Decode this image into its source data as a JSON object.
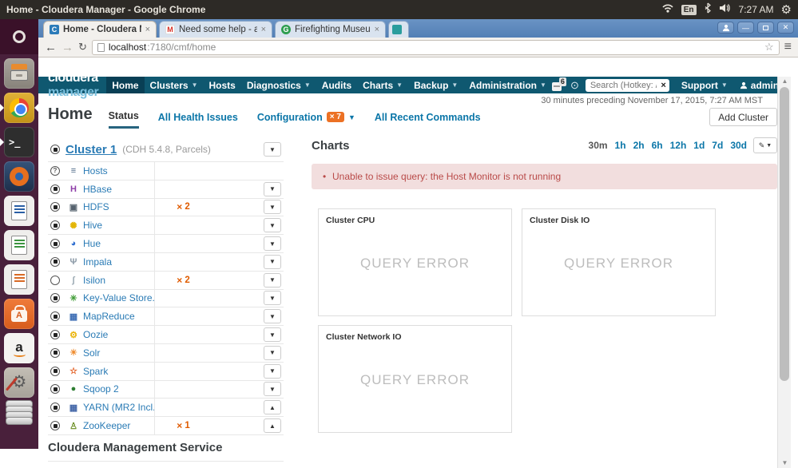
{
  "system_bar": {
    "title": "Home - Cloudera Manager - Google Chrome",
    "keyboard_indicator": "En",
    "time": "7:27 AM"
  },
  "launcher": {
    "items": [
      "ubuntu-dash",
      "files",
      "chrome",
      "terminal",
      "firefox",
      "libreoffice-writer",
      "libreoffice-calc",
      "libreoffice-impress",
      "software-center",
      "amazon",
      "system-settings",
      "disk-stack"
    ]
  },
  "browser": {
    "tabs": [
      {
        "label": "Home - Cloudera Ma",
        "favicon": "cloudera",
        "active": true,
        "partial": false
      },
      {
        "label": "Need some help - as",
        "favicon": "gmail",
        "active": false,
        "partial": false
      },
      {
        "label": "Firefighting Museu",
        "favicon": "g-green",
        "active": false,
        "partial": false
      },
      {
        "label": "",
        "favicon": "teal",
        "active": false,
        "partial": true
      }
    ],
    "url_host": "localhost",
    "url_path": ":7180/cmf/home"
  },
  "navbar": {
    "brand_primary": "cloudera",
    "brand_secondary": "manager",
    "items": [
      {
        "label": "Home",
        "active": true,
        "caret": false
      },
      {
        "label": "Clusters",
        "active": false,
        "caret": true
      },
      {
        "label": "Hosts",
        "active": false,
        "caret": false
      },
      {
        "label": "Diagnostics",
        "active": false,
        "caret": true
      },
      {
        "label": "Audits",
        "active": false,
        "caret": false
      },
      {
        "label": "Charts",
        "active": false,
        "caret": true
      },
      {
        "label": "Backup",
        "active": false,
        "caret": true
      },
      {
        "label": "Administration",
        "active": false,
        "caret": true
      }
    ],
    "parcel_badge": "6",
    "search_placeholder": "Search (Hotkey: /)",
    "support_label": "Support",
    "user_label": "admin"
  },
  "page": {
    "time_context": "30 minutes preceding November 17, 2015, 7:27 AM MST",
    "title": "Home",
    "tabs": [
      {
        "label": "Status",
        "active": true,
        "badge": "",
        "caret": false
      },
      {
        "label": "All Health Issues",
        "active": false,
        "badge": "",
        "caret": false
      },
      {
        "label": "Configuration",
        "active": false,
        "badge": "7",
        "caret": true
      },
      {
        "label": "All Recent Commands",
        "active": false,
        "badge": "",
        "caret": false
      }
    ],
    "add_cluster_label": "Add Cluster"
  },
  "cluster": {
    "name": "Cluster 1",
    "meta": "(CDH 5.4.8, Parcels)",
    "services": [
      {
        "name": "Hosts",
        "icon": "hosts",
        "glyph": "≡",
        "color": "#4a6785",
        "status": "unknown",
        "config_issues": "",
        "doc": false,
        "caret": ""
      },
      {
        "name": "HBase",
        "icon": "hbase",
        "glyph": "H",
        "color": "#8e3fa8",
        "status": "ok",
        "config_issues": "",
        "doc": true,
        "caret": "down"
      },
      {
        "name": "HDFS",
        "icon": "hdfs",
        "glyph": "▣",
        "color": "#55626e",
        "status": "ok",
        "config_issues": "2",
        "doc": true,
        "caret": "down"
      },
      {
        "name": "Hive",
        "icon": "hive",
        "glyph": "✺",
        "color": "#e3b505",
        "status": "ok",
        "config_issues": "",
        "doc": true,
        "caret": "down"
      },
      {
        "name": "Hue",
        "icon": "hue",
        "glyph": "◕",
        "color": "#2f6fd0",
        "status": "ok",
        "config_issues": "",
        "doc": false,
        "caret": "down"
      },
      {
        "name": "Impala",
        "icon": "impala",
        "glyph": "Ψ",
        "color": "#8a99a6",
        "status": "ok",
        "config_issues": "",
        "doc": false,
        "caret": "down"
      },
      {
        "name": "Isilon",
        "icon": "isilon",
        "glyph": "ʃ",
        "color": "#9aa9b2",
        "status": "none",
        "config_issues": "2",
        "doc": true,
        "caret": "down"
      },
      {
        "name": "Key-Value Store...",
        "icon": "kvstore",
        "glyph": "✳",
        "color": "#3f9c35",
        "status": "ok",
        "config_issues": "",
        "doc": false,
        "caret": "down"
      },
      {
        "name": "MapReduce",
        "icon": "mapreduce",
        "glyph": "▦",
        "color": "#3f6fb5",
        "status": "ok",
        "config_issues": "",
        "doc": true,
        "caret": "down"
      },
      {
        "name": "Oozie",
        "icon": "oozie",
        "glyph": "⚙",
        "color": "#eab308",
        "status": "ok",
        "config_issues": "",
        "doc": false,
        "caret": "down"
      },
      {
        "name": "Solr",
        "icon": "solr",
        "glyph": "☀",
        "color": "#ef8b2c",
        "status": "ok",
        "config_issues": "",
        "doc": true,
        "caret": "down"
      },
      {
        "name": "Spark",
        "icon": "spark",
        "glyph": "☆",
        "color": "#e25a1c",
        "status": "ok",
        "config_issues": "",
        "doc": true,
        "caret": "down"
      },
      {
        "name": "Sqoop 2",
        "icon": "sqoop",
        "glyph": "●",
        "color": "#2e7d32",
        "status": "ok",
        "config_issues": "",
        "doc": false,
        "caret": "down"
      },
      {
        "name": "YARN (MR2 Incl...",
        "icon": "yarn",
        "glyph": "▦",
        "color": "#4467a8",
        "status": "ok",
        "config_issues": "",
        "doc": true,
        "caret": "up"
      },
      {
        "name": "ZooKeeper",
        "icon": "zookeeper",
        "glyph": "♙",
        "color": "#6b8e23",
        "status": "ok",
        "config_issues": "1",
        "doc": false,
        "caret": "up"
      }
    ],
    "footer_heading": "Cloudera Management Service"
  },
  "charts": {
    "heading": "Charts",
    "ranges": [
      "30m",
      "1h",
      "2h",
      "6h",
      "12h",
      "1d",
      "7d",
      "30d"
    ],
    "active_range": "30m",
    "alert": "Unable to issue query: the Host Monitor is not running",
    "panels": [
      {
        "title": "Cluster CPU",
        "message": "QUERY ERROR"
      },
      {
        "title": "Cluster Disk IO",
        "message": "QUERY ERROR"
      },
      {
        "title": "Cluster Network IO",
        "message": "QUERY ERROR"
      }
    ]
  },
  "colors": {
    "navbar": "#0f5870",
    "navbar_active": "#093f55",
    "brand_secondary": "#79bfdd",
    "link_blue": "#0b76a8",
    "service_link": "#2a7bb5",
    "badge_orange": "#ec7124",
    "issue_orange": "#e05c00",
    "alert_bg": "#f2dede",
    "alert_text": "#b94a48",
    "query_error_text": "#bdbdbd"
  }
}
